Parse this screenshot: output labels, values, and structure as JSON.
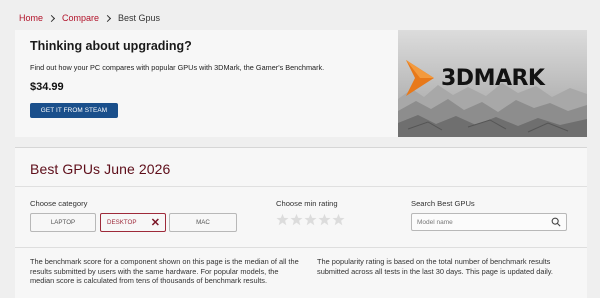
{
  "breadcrumb": {
    "home": "Home",
    "compare": "Compare",
    "current": "Best Gpus"
  },
  "promo": {
    "title": "Thinking about upgrading?",
    "description": "Find out how your PC compares with popular GPUs with 3DMark, the Gamer's Benchmark.",
    "price": "$34.99",
    "button_label": "GET IT FROM STEAM",
    "logo_text": "3DMARK"
  },
  "page": {
    "title": "Best GPUs June 2026",
    "category_label": "Choose category",
    "categories": [
      "LAPTOP",
      "DESKTOP",
      "MAC"
    ],
    "selected_category": "DESKTOP",
    "rating_label": "Choose min rating",
    "rating_stars": 5,
    "rating_selected": 0,
    "search_label": "Search Best GPUs",
    "search_placeholder": "Model name",
    "search_value": "",
    "info_left": "The benchmark score for a component shown on this page is the median of all the results submitted by users with the same hardware. For popular models, the median score is calculated from tens of thousands of benchmark results.",
    "info_right": "The popularity rating is based on the total number of benchmark results submitted across all tests in the last 30 days. This page is updated daily."
  },
  "colors": {
    "accent": "#b2132a",
    "title": "#5e0e1a",
    "button": "#1a4f8b",
    "logo_orange": "#e8791a"
  },
  "icons": {
    "separator": "chevron-right-icon",
    "clear": "close-icon",
    "star": "star-icon",
    "search": "search-icon"
  }
}
